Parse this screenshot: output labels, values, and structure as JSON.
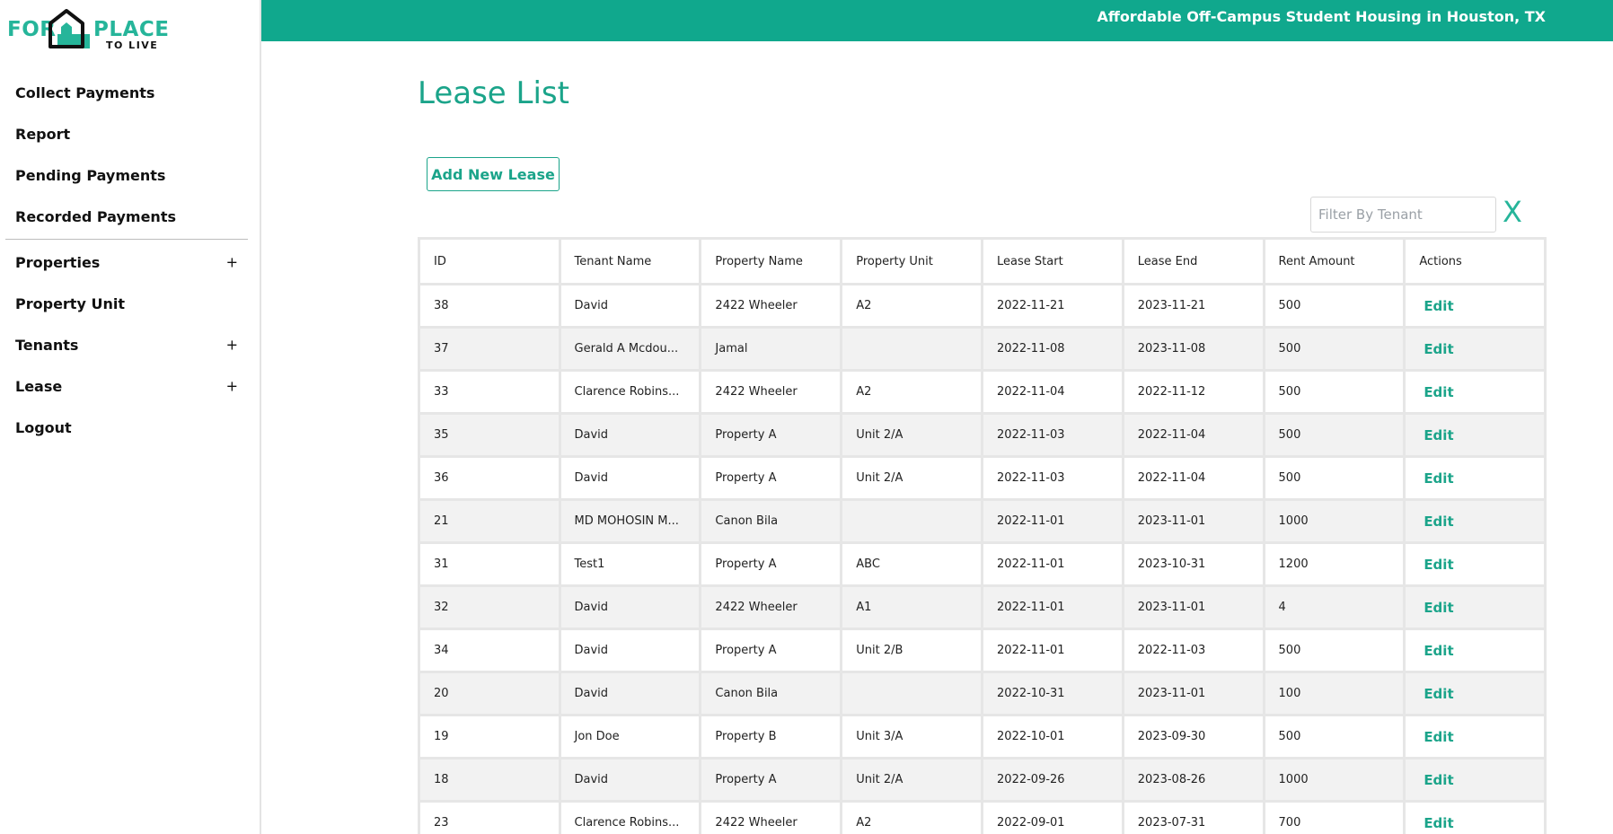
{
  "logo": {
    "word1": "FOR",
    "word2": "PLACE",
    "word3": "TO LIVE"
  },
  "header": {
    "title": "Affordable Off-Campus Student Housing in Houston, TX"
  },
  "sidebar": {
    "items": [
      {
        "label": "Collect Payments"
      },
      {
        "label": "Report"
      },
      {
        "label": "Pending Payments"
      },
      {
        "label": "Recorded Payments"
      },
      {
        "label": "Properties",
        "expand": "+"
      },
      {
        "label": "Property Unit"
      },
      {
        "label": "Tenants",
        "expand": "+"
      },
      {
        "label": "Lease",
        "expand": "+"
      },
      {
        "label": "Logout"
      }
    ]
  },
  "main": {
    "title": "Lease List",
    "add_button": "Add New Lease",
    "filter_placeholder": "Filter By Tenant",
    "clear_label": "X"
  },
  "table": {
    "columns": [
      "ID",
      "Tenant Name",
      "Property Name",
      "Property Unit",
      "Lease Start",
      "Lease End",
      "Rent Amount",
      "Actions"
    ],
    "action_label": "Edit",
    "rows": [
      {
        "id": "38",
        "tenant": "David",
        "property": "2422 Wheeler",
        "unit": "A2",
        "start": "2022-11-21",
        "end": "2023-11-21",
        "rent": "500"
      },
      {
        "id": "37",
        "tenant": "Gerald A Mcdou...",
        "property": "Jamal",
        "unit": "",
        "start": "2022-11-08",
        "end": "2023-11-08",
        "rent": "500"
      },
      {
        "id": "33",
        "tenant": "Clarence Robins...",
        "property": "2422 Wheeler",
        "unit": "A2",
        "start": "2022-11-04",
        "end": "2022-11-12",
        "rent": "500"
      },
      {
        "id": "35",
        "tenant": "David",
        "property": "Property A",
        "unit": "Unit 2/A",
        "start": "2022-11-03",
        "end": "2022-11-04",
        "rent": "500"
      },
      {
        "id": "36",
        "tenant": "David",
        "property": "Property A",
        "unit": "Unit 2/A",
        "start": "2022-11-03",
        "end": "2022-11-04",
        "rent": "500"
      },
      {
        "id": "21",
        "tenant": "MD MOHOSIN M...",
        "property": "Canon Bila",
        "unit": "",
        "start": "2022-11-01",
        "end": "2023-11-01",
        "rent": "1000"
      },
      {
        "id": "31",
        "tenant": "Test1",
        "property": "Property A",
        "unit": "ABC",
        "start": "2022-11-01",
        "end": "2023-10-31",
        "rent": "1200"
      },
      {
        "id": "32",
        "tenant": "David",
        "property": "2422 Wheeler",
        "unit": "A1",
        "start": "2022-11-01",
        "end": "2023-11-01",
        "rent": "4"
      },
      {
        "id": "34",
        "tenant": "David",
        "property": "Property A",
        "unit": "Unit 2/B",
        "start": "2022-11-01",
        "end": "2022-11-03",
        "rent": "500"
      },
      {
        "id": "20",
        "tenant": "David",
        "property": "Canon Bila",
        "unit": "",
        "start": "2022-10-31",
        "end": "2023-11-01",
        "rent": "100"
      },
      {
        "id": "19",
        "tenant": "Jon Doe",
        "property": "Property B",
        "unit": "Unit 3/A",
        "start": "2022-10-01",
        "end": "2023-09-30",
        "rent": "500"
      },
      {
        "id": "18",
        "tenant": "David",
        "property": "Property A",
        "unit": "Unit 2/A",
        "start": "2022-09-26",
        "end": "2023-08-26",
        "rent": "1000"
      },
      {
        "id": "23",
        "tenant": "Clarence Robins...",
        "property": "2422 Wheeler",
        "unit": "A2",
        "start": "2022-09-01",
        "end": "2023-07-31",
        "rent": "700"
      }
    ]
  },
  "colors": {
    "accent": "#10a88d",
    "accent_text": "#1ba48a",
    "row_alt": "#f2f2f2"
  }
}
